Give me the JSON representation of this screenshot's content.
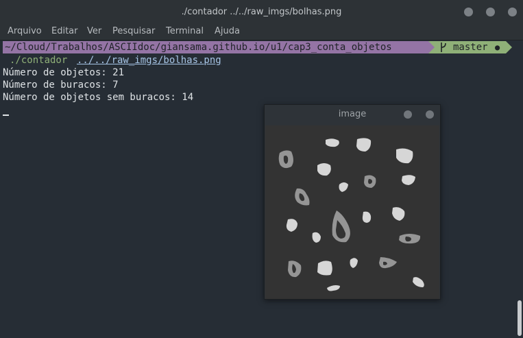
{
  "window": {
    "title": "./contador ../../raw_imgs/bolhas.png"
  },
  "menu": {
    "items": [
      "Arquivo",
      "Editar",
      "Ver",
      "Pesquisar",
      "Terminal",
      "Ajuda"
    ]
  },
  "prompt": {
    "path": "~/Cloud/Trabalhos/ASCIIdoc/giansama.github.io/u1/cap3_conta_objetos",
    "branch": "master",
    "dirty_mark": "●",
    "branch_icon": "git-branch-icon"
  },
  "command": {
    "program": "./contador",
    "argument": "../../raw_imgs/bolhas.png"
  },
  "output": [
    "Número de objetos: 21",
    "Número de buracos: 7",
    "Número de objetos sem buracos: 14"
  ],
  "image_window": {
    "title": "image"
  },
  "colors": {
    "terminal_bg": "#262d35",
    "prompt_path_bg": "#9474a5",
    "prompt_git_bg": "#8fb078",
    "command_green": "#8fb078",
    "argument_blue": "#a7c5e6",
    "blob_light": "#d6d6d6",
    "blob_gray": "#959595"
  }
}
